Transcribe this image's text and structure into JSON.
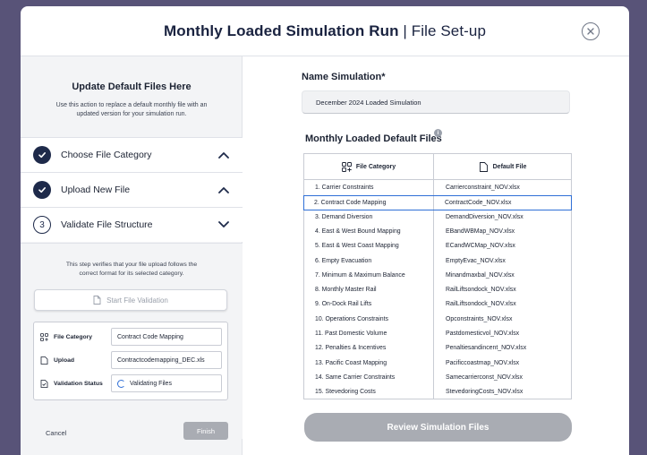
{
  "header": {
    "title_bold": "Monthly Loaded Simulation Run",
    "title_sep": " | ",
    "title_rest": "File Set-up",
    "close_icon": "close-circle-icon"
  },
  "left_panel": {
    "title": "Update Default Files Here",
    "description": "Use this action to replace a default monthly file with an updated version for your simulation run.",
    "steps": [
      {
        "status": "done",
        "number": "",
        "label": "Choose File Category",
        "chevron": "up"
      },
      {
        "status": "done",
        "number": "",
        "label": "Upload New File",
        "chevron": "up"
      },
      {
        "status": "todo",
        "number": "3",
        "label": "Validate File Structure",
        "chevron": "down"
      }
    ],
    "verify_text": "This step verifies that your file upload follows the correct format for its selected category.",
    "start_button": "Start File Validation",
    "info": {
      "category_label": "File Category",
      "category_value": "Contract Code Mapping",
      "upload_label": "Upload",
      "upload_value": "Contractcodemapping_DEC.xls",
      "status_label": "Validation Status",
      "status_value": "Validating Files"
    },
    "cancel": "Cancel",
    "finish": "Finish"
  },
  "right_panel": {
    "name_label": "Name Simulation*",
    "name_value": "December 2024 Loaded Simulation",
    "files_label": "Monthly Loaded Default Files",
    "table": {
      "col_category": "File Category",
      "col_default": "Default File",
      "selected_index": 1,
      "rows": [
        {
          "category": "1. Carrier Constraints",
          "file": "Carrierconstraint_NOV.xlsx"
        },
        {
          "category": "2. Contract Code Mapping",
          "file": "ContractCode_NOV.xlsx"
        },
        {
          "category": "3. Demand Diversion",
          "file": "DemandDiversion_NOV.xlsx"
        },
        {
          "category": "4. East & West Bound Mapping",
          "file": "EBandWBMap_NOV.xlsx"
        },
        {
          "category": "5. East & West Coast Mapping",
          "file": "ECandWCMap_NOV.xlsx"
        },
        {
          "category": "6. Empty Evacuation",
          "file": "EmptyEvac_NOV.xlsx"
        },
        {
          "category": "7. Minimum & Maximum Balance",
          "file": "Minandmaxbal_NOV.xlsx"
        },
        {
          "category": "8. Monthly Master Rail",
          "file": "RailLiftsondock_NOV.xlsx"
        },
        {
          "category": "9. On-Dock Rail Lifts",
          "file": "RailLiftsondock_NOV.xlsx"
        },
        {
          "category": "10. Operations Constraints",
          "file": "Opconstraints_NOV.xlsx"
        },
        {
          "category": "11. Past Domestic Volume",
          "file": "Pastdomesticvol_NOV.xlsx"
        },
        {
          "category": "12. Penalties & Incentives",
          "file": "Penaltiesandincent_NOV.xlsx"
        },
        {
          "category": "13. Pacific Coast Mapping",
          "file": "Pacificcoastmap_NOV.xlsx"
        },
        {
          "category": "14. Same Carrier Constraints",
          "file": "Samecarrierconst_NOV.xlsx"
        },
        {
          "category": "15. Stevedoring Costs",
          "file": "StevedoringCosts_NOV.xlsx"
        }
      ]
    },
    "review_button": "Review Simulation Files"
  }
}
